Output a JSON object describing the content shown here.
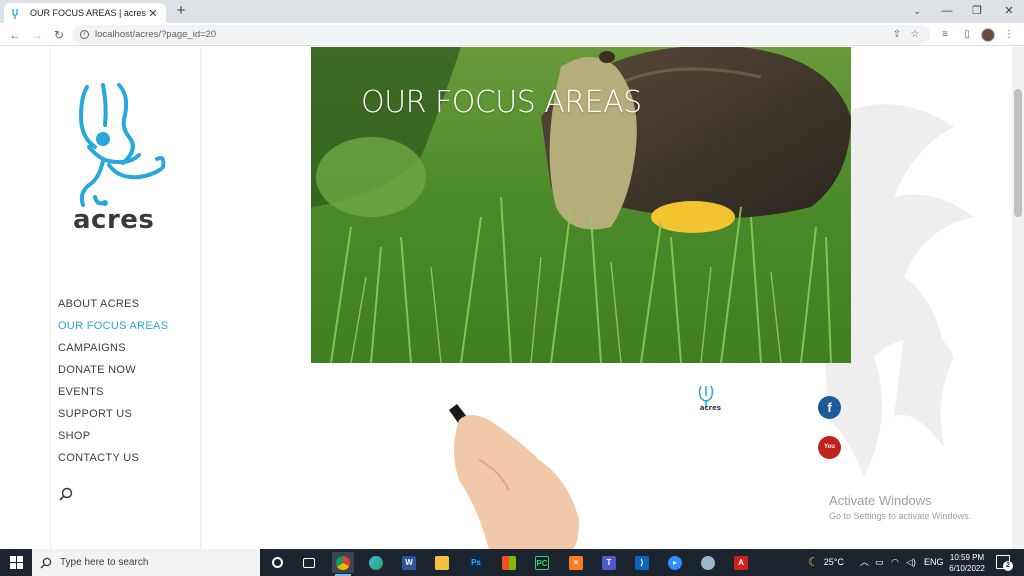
{
  "browser": {
    "tab_title": "OUR FOCUS AREAS | acres",
    "tab_close": "✕",
    "new_tab": "+",
    "url": "localhost/acres/?page_id=20",
    "window_minimize": "—",
    "window_maximize": "❐",
    "window_close": "✕",
    "tab_search": "⌄"
  },
  "site": {
    "logo_text": "acres",
    "nav_items": [
      {
        "label": "ABOUT ACRES",
        "active": false
      },
      {
        "label": "OUR FOCUS AREAS",
        "active": true
      },
      {
        "label": "CAMPAIGNS",
        "active": false
      },
      {
        "label": "DONATE NOW",
        "active": false
      },
      {
        "label": "EVENTS",
        "active": false
      },
      {
        "label": "SUPPORT US",
        "active": false
      },
      {
        "label": "SHOP",
        "active": false
      },
      {
        "label": "CONTACTY US",
        "active": false
      }
    ],
    "hero_title": "OUR FOCUS AREAS",
    "video_logo_text": "acres",
    "social": {
      "facebook": "f",
      "youtube": "You Tube"
    },
    "accent_color": "#27a7dc"
  },
  "windows_activation": {
    "title": "Activate Windows",
    "subtitle": "Go to Settings to activate Windows."
  },
  "taskbar": {
    "search_placeholder": "Type here to search",
    "temperature": "25°C",
    "language": "ENG",
    "time": "10:59 PM",
    "date": "6/10/2022",
    "notification_count": "2",
    "apps": [
      "task-view",
      "chrome",
      "edge",
      "word",
      "file-explorer",
      "photoshop",
      "microsoft-store",
      "pycharm",
      "xampp",
      "teams",
      "vscode",
      "zoom",
      "app",
      "acrobat"
    ]
  },
  "icons": {
    "back": "←",
    "forward": "→",
    "reload": "↻",
    "star": "☆",
    "share": "⇪",
    "menu": "⋮",
    "queue": "≡",
    "side_panel": "▯",
    "info": "i"
  }
}
